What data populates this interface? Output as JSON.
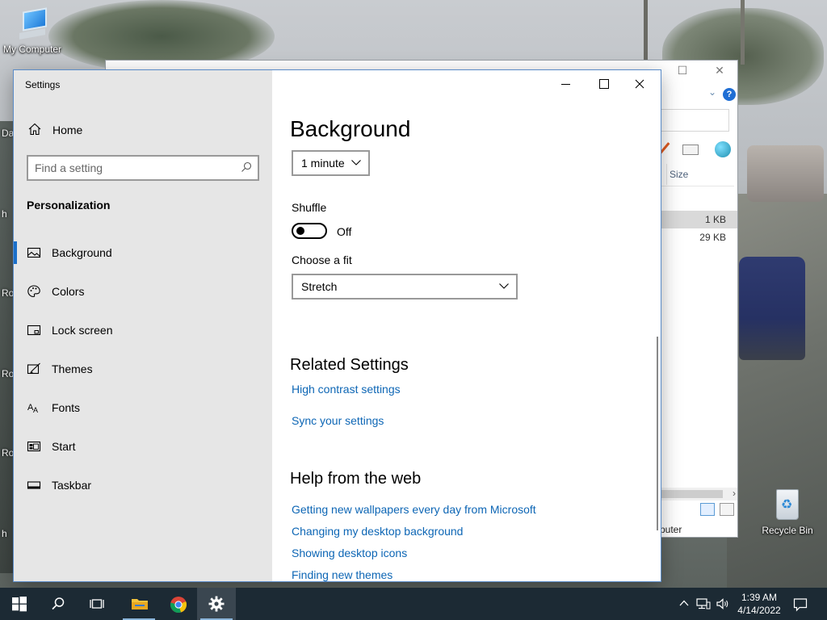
{
  "desktop": {
    "icons": [
      {
        "label": "My Computer"
      },
      {
        "label": "Recycle Bin"
      }
    ],
    "edge_labels": [
      "Da",
      "h",
      "Ro",
      "Ro",
      "Ro",
      "h"
    ]
  },
  "explorer": {
    "column_header": "Size",
    "rows": [
      {
        "size": "1 KB"
      },
      {
        "size": "29 KB"
      }
    ],
    "status_partial": "puter"
  },
  "settings": {
    "window_title": "Settings",
    "nav": {
      "home_label": "Home",
      "search_placeholder": "Find a setting",
      "section": "Personalization",
      "items": [
        {
          "label": "Background",
          "icon": "picture-icon",
          "active": true
        },
        {
          "label": "Colors",
          "icon": "palette-icon"
        },
        {
          "label": "Lock screen",
          "icon": "lock-screen-icon"
        },
        {
          "label": "Themes",
          "icon": "themes-icon"
        },
        {
          "label": "Fonts",
          "icon": "fonts-icon"
        },
        {
          "label": "Start",
          "icon": "start-icon"
        },
        {
          "label": "Taskbar",
          "icon": "taskbar-icon"
        }
      ]
    },
    "main": {
      "title": "Background",
      "interval_value": "1 minute",
      "shuffle_label": "Shuffle",
      "shuffle_state": "Off",
      "fit_label": "Choose a fit",
      "fit_value": "Stretch",
      "related_heading": "Related Settings",
      "related_links": [
        "High contrast settings",
        "Sync your settings"
      ],
      "help_heading": "Help from the web",
      "help_links": [
        "Getting new wallpapers every day from Microsoft",
        "Changing my desktop background",
        "Showing desktop icons",
        "Finding new themes"
      ]
    }
  },
  "taskbar": {
    "time": "1:39 AM",
    "date": "4/14/2022"
  },
  "colors": {
    "accent": "#1a6fc9",
    "link": "#0d66b5",
    "taskbar": "#1c2a34",
    "nav_bg": "#e6e6e6"
  }
}
